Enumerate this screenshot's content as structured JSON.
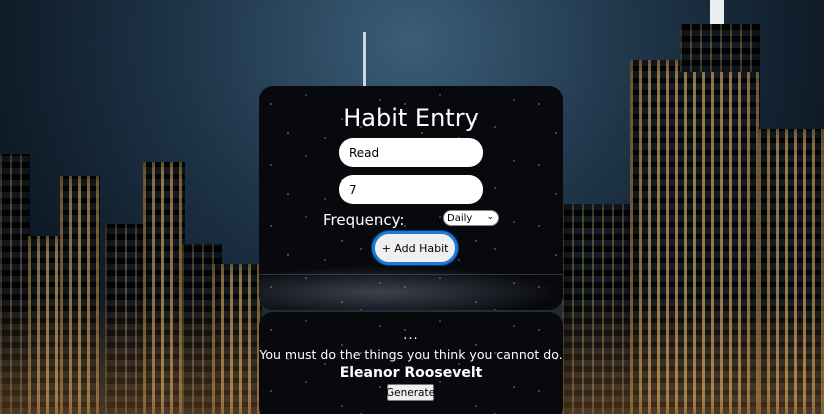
{
  "habit_form": {
    "title": "Habit Entry",
    "habit_name_value": "Read",
    "habit_days_value": "7",
    "frequency_label": "Frequency:",
    "frequency_selected": "Daily",
    "add_button_label": "+ Add Habit"
  },
  "quote_panel": {
    "dots": "...",
    "quote_text": "You must do the things you think you cannot do.",
    "author": "Eleanor Roosevelt",
    "generate_button_label": "Generate"
  },
  "colors": {
    "focus_ring": "#1a7cd8",
    "card_background": "#07090d",
    "text": "#ffffff"
  }
}
